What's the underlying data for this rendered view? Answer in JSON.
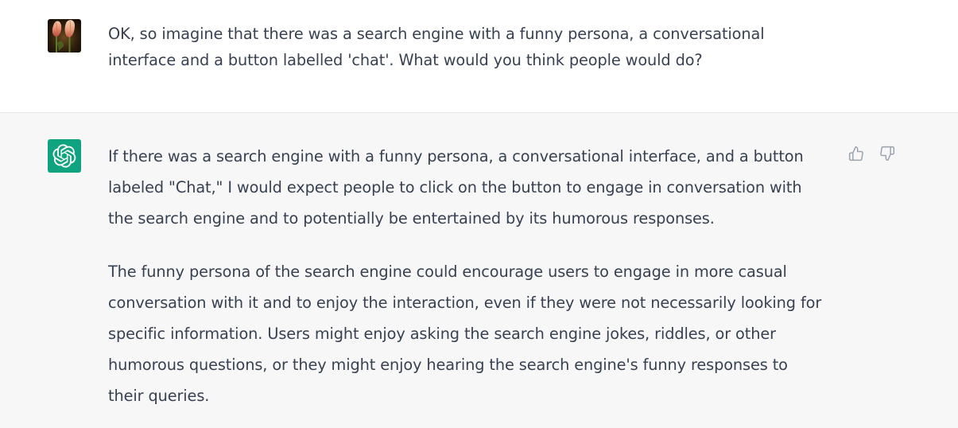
{
  "user_message": {
    "text": "OK, so imagine that there was a search engine with a funny persona, a conversational interface and a button labelled 'chat'. What would you think people would do?"
  },
  "assistant_message": {
    "paragraphs": [
      "If there was a search engine with a funny persona, a conversational interface, and a button labeled \"Chat,\" I would expect people to click on the button to engage in conversation with the search engine and to potentially be entertained by its humorous responses.",
      "The funny persona of the search engine could encourage users to engage in more casual conversation with it and to enjoy the interaction, even if they were not necessarily looking for specific information. Users might enjoy asking the search engine jokes, riddles, or other humorous questions, or they might enjoy hearing the search engine's funny responses to their queries."
    ]
  },
  "icons": {
    "user_avatar": "tulip-photo-avatar",
    "assistant_avatar": "openai-logo-icon",
    "thumbs_up": "thumbs-up-icon",
    "thumbs_down": "thumbs-down-icon"
  },
  "colors": {
    "assistant_bg": "#f7f7f8",
    "user_bg": "#ffffff",
    "brand_green": "#10a37f",
    "text": "#374151",
    "icon_gray": "#9ca3af"
  }
}
